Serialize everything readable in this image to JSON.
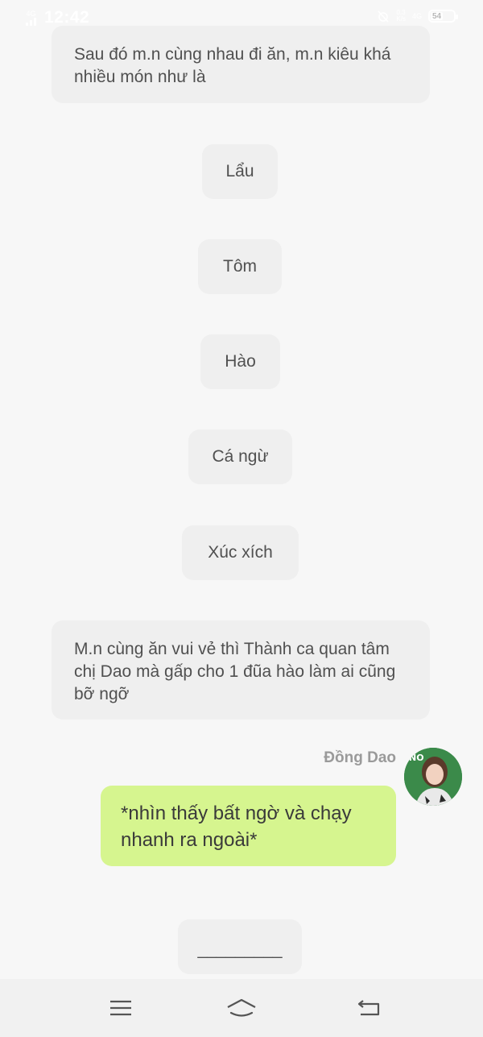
{
  "status_bar": {
    "network_small": "4G",
    "time": "12:42",
    "speed_value": "0.3",
    "speed_unit": "K/s",
    "network_right": "4G",
    "battery": "54"
  },
  "messages": {
    "narration_1": "Sau đó m.n cùng nhau đi ăn, m.n kiêu khá nhiều món như là",
    "items": [
      "Lẩu",
      "Tôm",
      "Hào",
      "Cá ngừ",
      "Xúc xích"
    ],
    "narration_2": "M.n cùng ăn vui vẻ thì Thành ca quan tâm chị Dao mà gấp cho 1 đũa hào làm ai cũng bỡ ngỡ",
    "sender_name": "Đồng Dao",
    "sender_message": "*nhìn thấy bất ngờ và chạy nhanh ra ngoài*",
    "input_placeholder": "_________"
  },
  "icons": {
    "menu": "menu-icon",
    "home": "home-icon",
    "back": "back-icon",
    "alarm": "alarm-off-icon"
  },
  "colors": {
    "background": "#f7f7f7",
    "bubble": "#efefef",
    "user_bubble": "#d6f58f",
    "avatar_bg": "#3b8a4a"
  }
}
